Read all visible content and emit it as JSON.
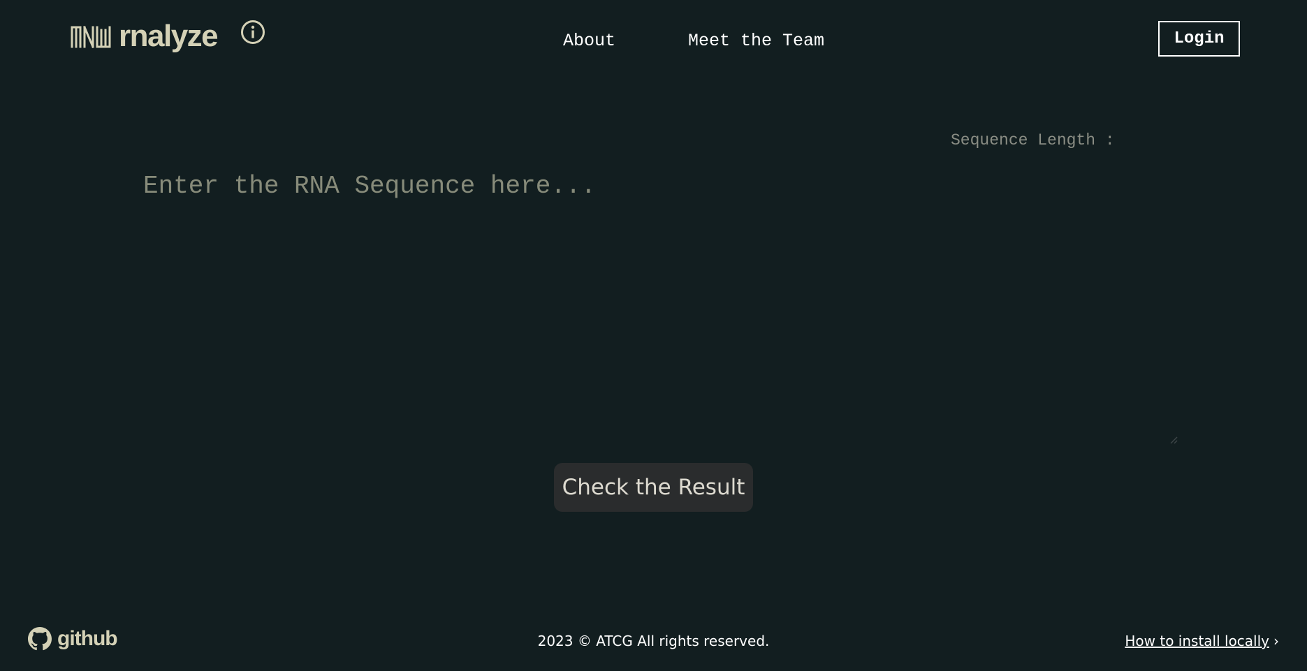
{
  "header": {
    "brand": "rnalyze",
    "logo_icon": "rna-strand-logo-icon",
    "info_icon": "info-icon",
    "nav": {
      "about": "About",
      "team": "Meet the Team"
    },
    "login_label": "Login"
  },
  "main": {
    "sequence_length_label": "Sequence Length :",
    "sequence_placeholder": "Enter the RNA Sequence here...",
    "sequence_value": "",
    "submit_label": "Check the Result"
  },
  "footer": {
    "github_label": "github",
    "github_icon": "github-icon",
    "copyright": "2023 © ATCG All rights reserved.",
    "install_label": "How to install locally",
    "install_chevron": "›"
  },
  "colors": {
    "background": "#121e20",
    "brand": "#d4d1b6",
    "button_bg": "#2a2c2d",
    "muted_text": "#8a8d84"
  }
}
